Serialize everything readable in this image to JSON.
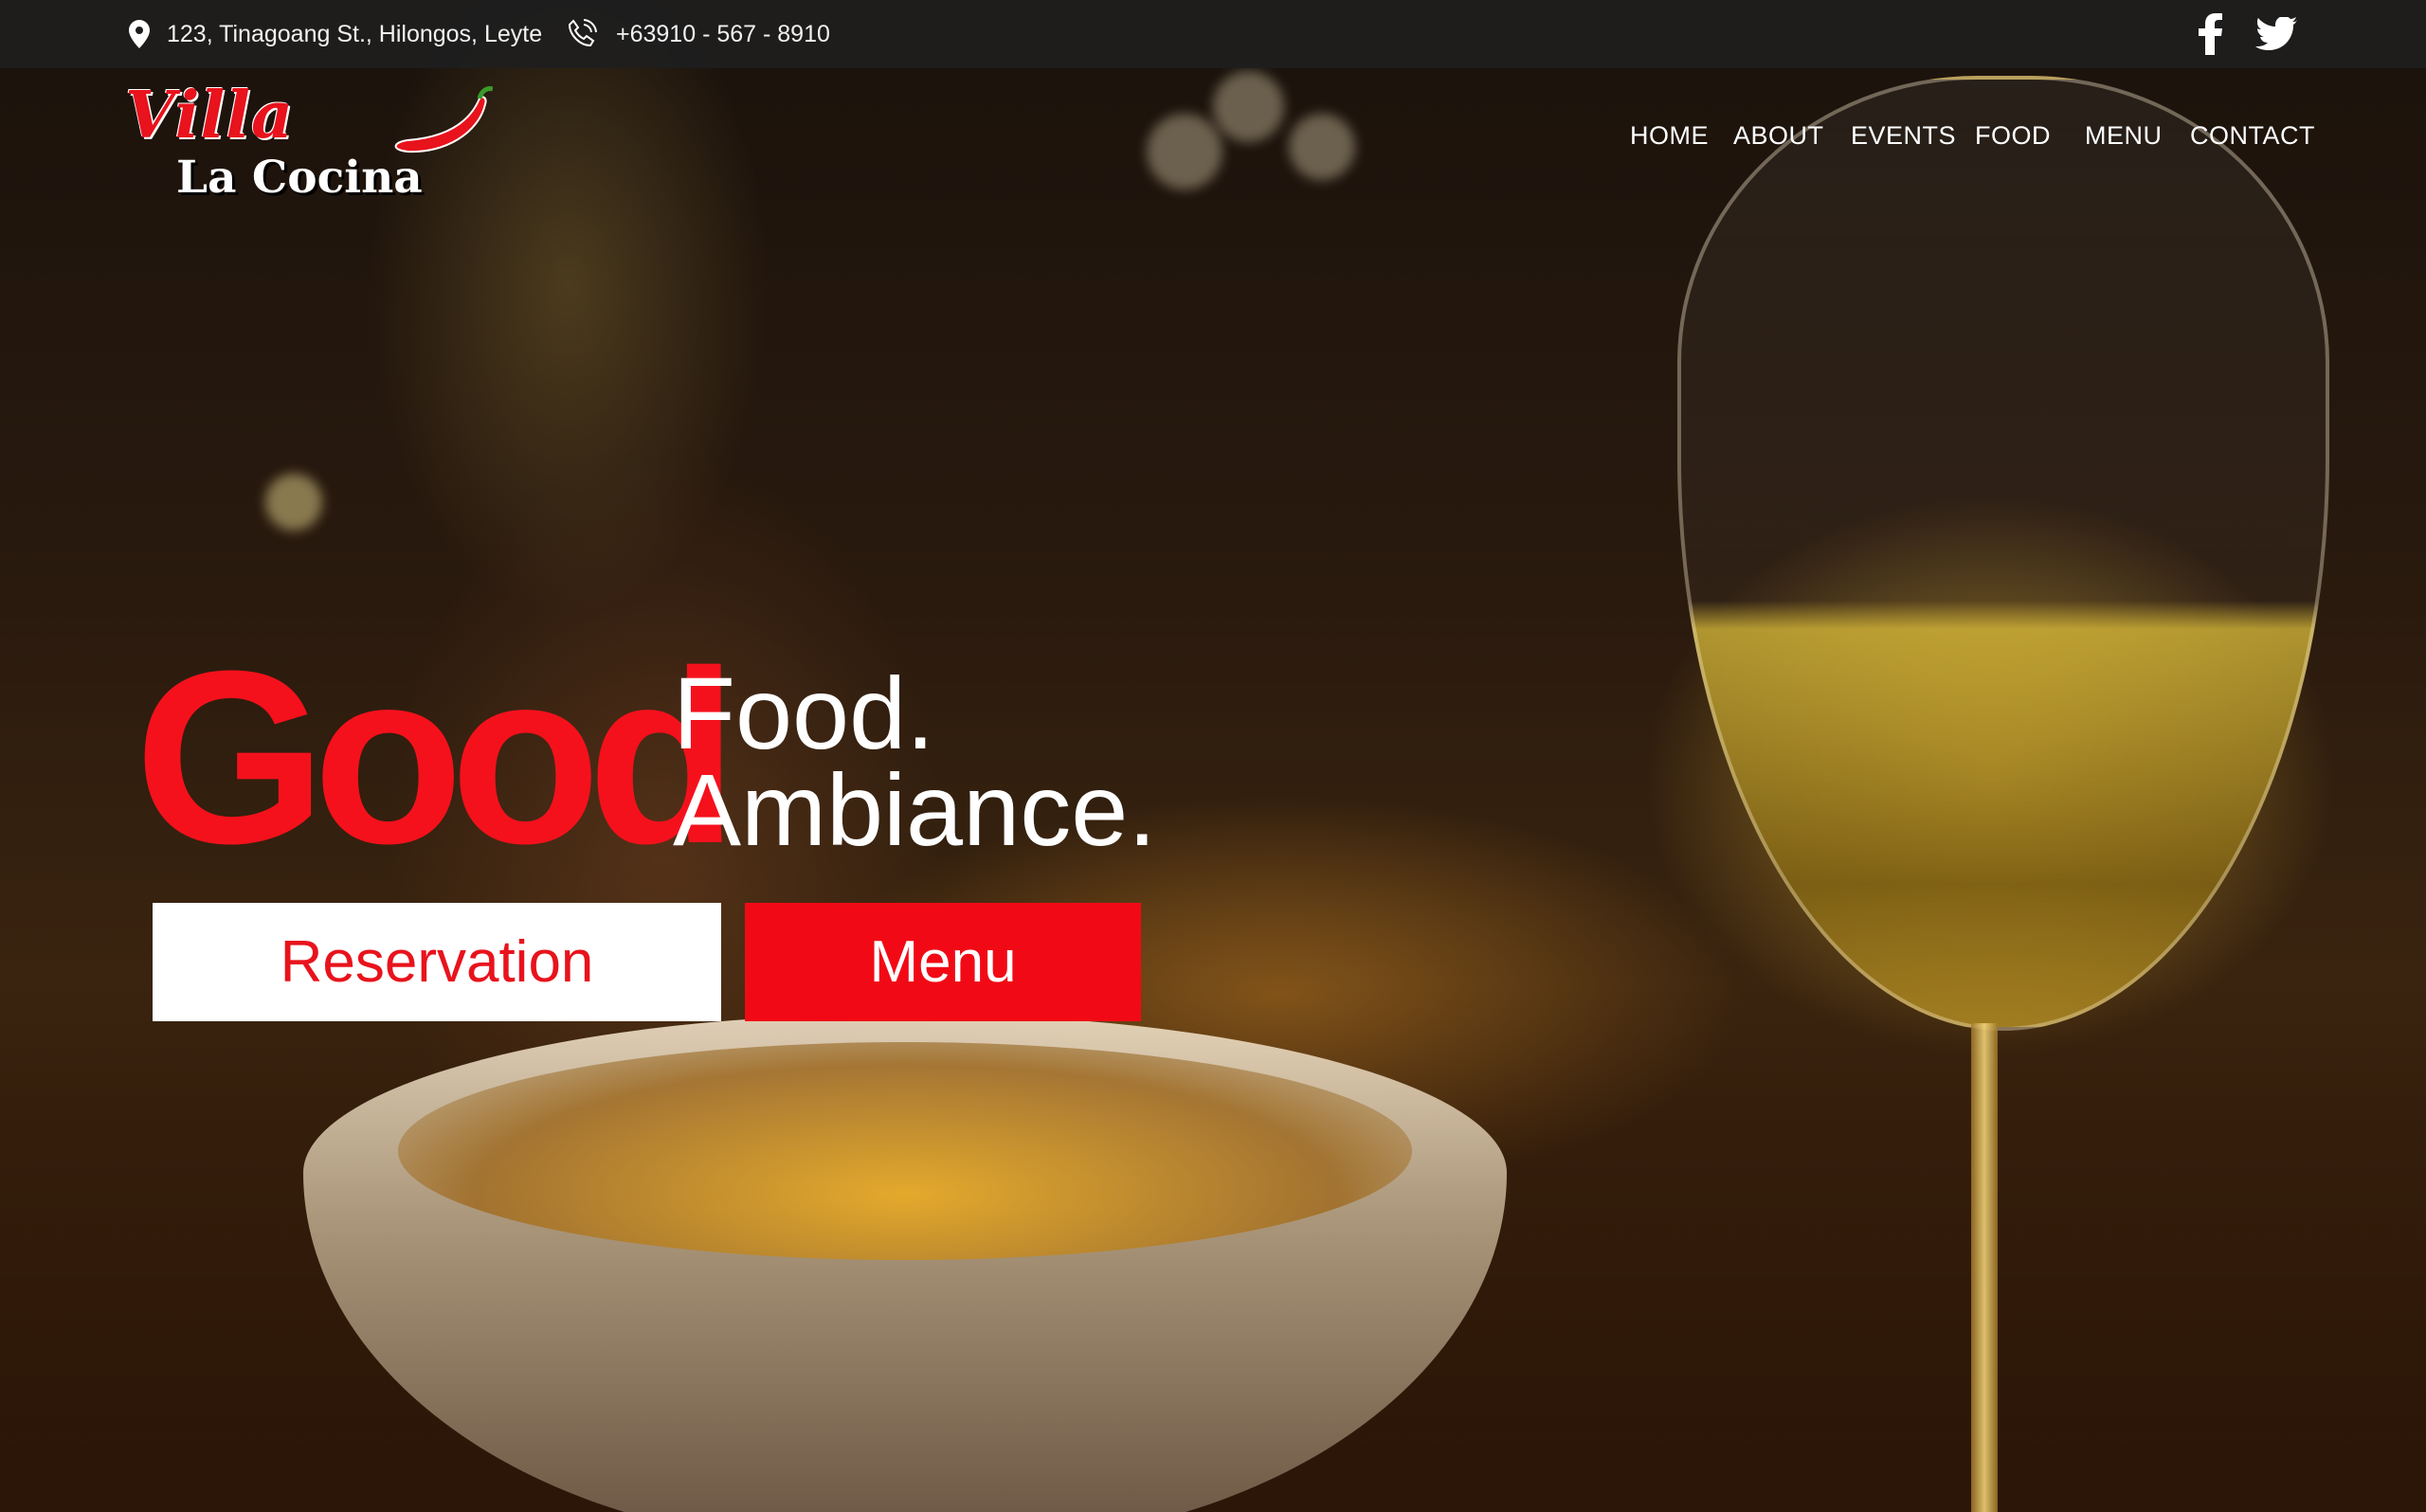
{
  "topbar": {
    "address": "123, Tinagoang St., Hilongos, Leyte",
    "phone": "+63910 - 567 - 8910",
    "social": [
      {
        "icon": "facebook-icon"
      },
      {
        "icon": "twitter-icon"
      }
    ]
  },
  "logo": {
    "villa": "Villa",
    "name": "La Cocina"
  },
  "nav": {
    "items": [
      "HOME",
      "ABOUT",
      "EVENTS",
      "FOOD",
      "MENU",
      "CONTACT"
    ]
  },
  "hero": {
    "highlight": "Good",
    "line1": "Food.",
    "line2": "Ambiance."
  },
  "buttons": {
    "reservation": "Reservation",
    "menu": "Menu"
  },
  "colors": {
    "brand_red": "#f10a15",
    "topbar_bg": "#1e1e1e",
    "text_white": "#ffffff"
  }
}
